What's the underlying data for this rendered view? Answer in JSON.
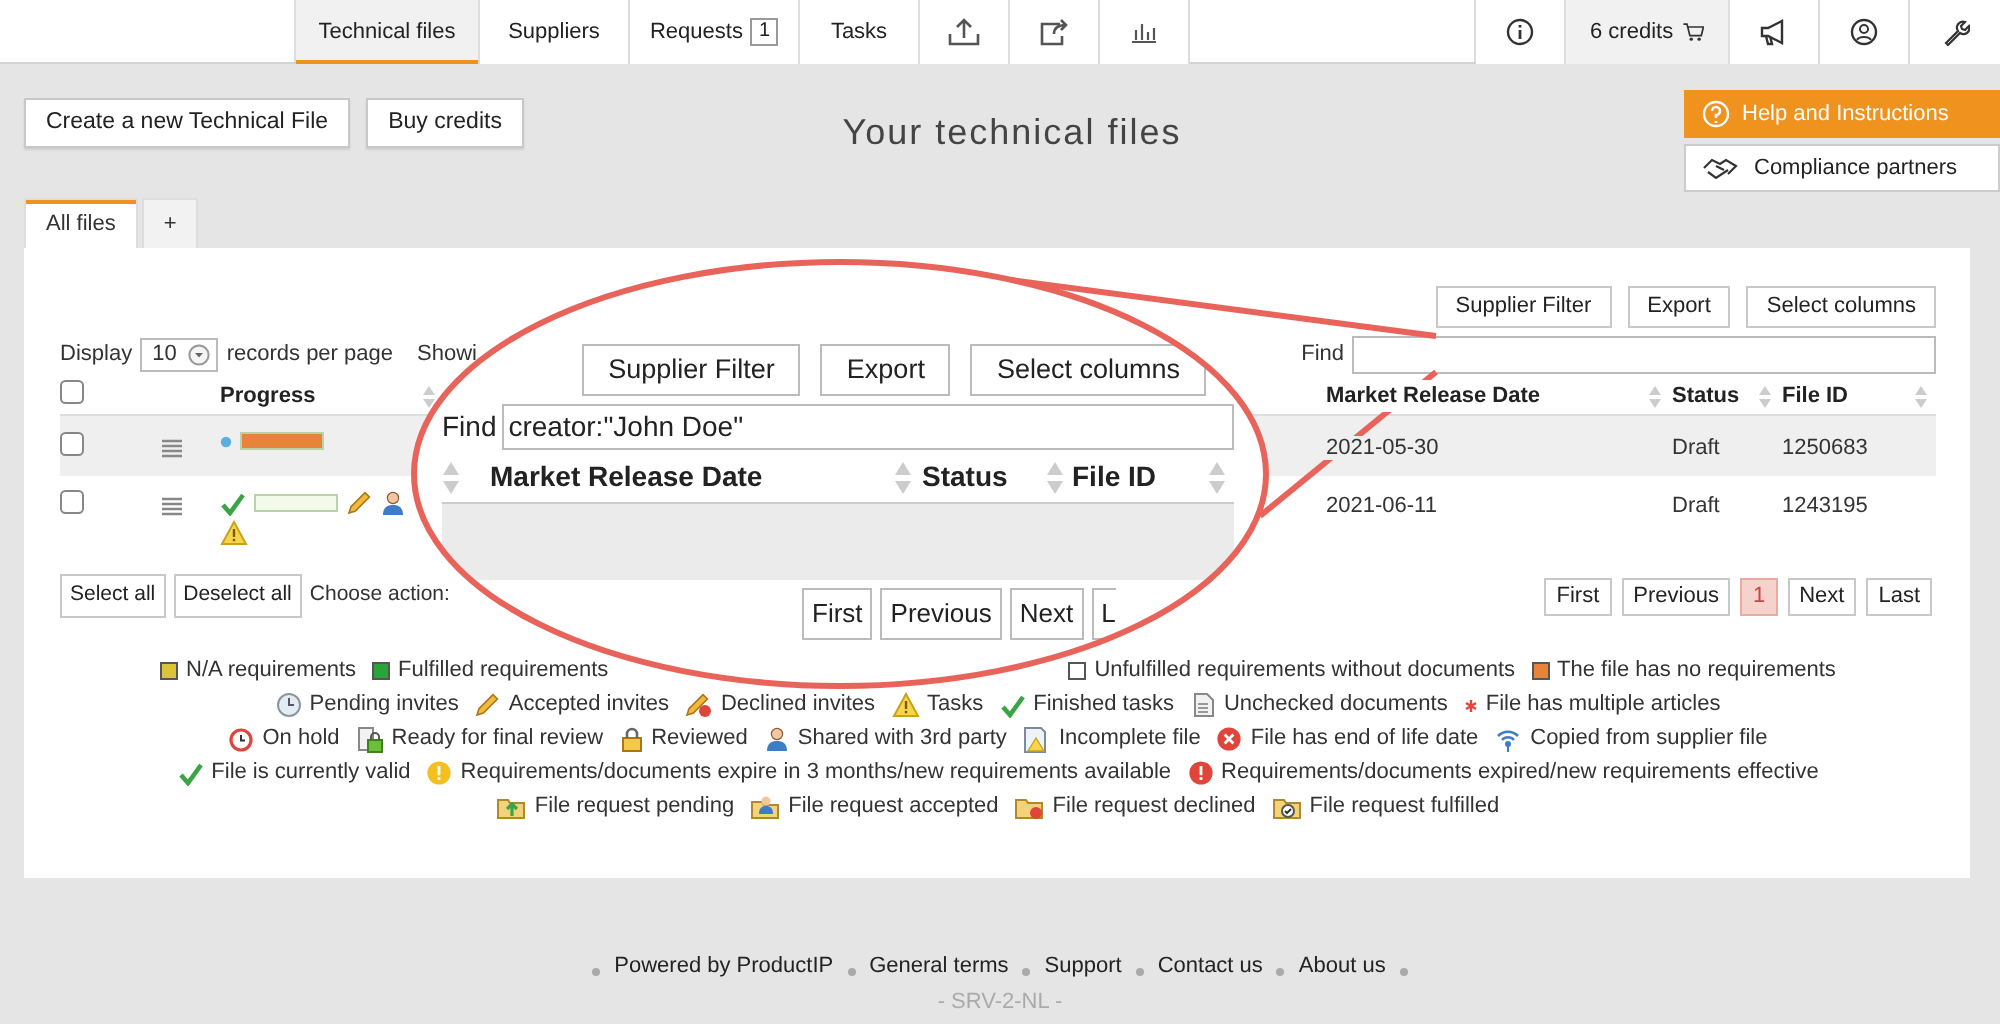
{
  "nav": {
    "tabs": [
      {
        "label": "Technical files",
        "selected": true
      },
      {
        "label": "Suppliers",
        "selected": false
      },
      {
        "label": "Requests",
        "badge": "1",
        "selected": false
      },
      {
        "label": "Tasks",
        "selected": false
      }
    ],
    "credits": "6 credits"
  },
  "actions": [
    "Create a new Technical File",
    "Buy credits"
  ],
  "page_title": "Your technical files",
  "side_buttons": [
    {
      "label": "Help and Instructions",
      "kind": "help"
    },
    {
      "label": "Compliance partners",
      "kind": "partners"
    }
  ],
  "file_tabs": [
    {
      "label": "All files",
      "selected": true
    },
    {
      "label": "+",
      "selected": false
    }
  ],
  "toolbar": [
    "Supplier Filter",
    "Export",
    "Select columns"
  ],
  "display": {
    "prefix": "Display",
    "value": "10",
    "suffix": "records per page"
  },
  "showing": "Showi",
  "find_label": "Find",
  "table": {
    "select_all_checked": false,
    "columns_left": [
      "Progress"
    ],
    "columns_right": [
      "Market Release Date",
      "Status",
      "File ID"
    ],
    "rows": [
      {
        "checked": false,
        "progress": {
          "level": 1,
          "color": "#e8833a"
        },
        "before": [
          {
            "kind": "dot"
          }
        ],
        "after": [],
        "below": [],
        "market_release_date": "2021-05-30",
        "status": "Draft",
        "file_id": "1250683"
      },
      {
        "checked": false,
        "progress": {
          "level": 0
        },
        "before": [
          {
            "kind": "check"
          }
        ],
        "after": [
          {
            "kind": "pencil"
          },
          {
            "kind": "person"
          }
        ],
        "below": [
          {
            "kind": "warning"
          }
        ],
        "market_release_date": "2021-06-11",
        "status": "Draft",
        "file_id": "1243195"
      }
    ]
  },
  "bulk": [
    "Select all",
    "Deselect all"
  ],
  "choose_action": "Choose action:",
  "pagination": [
    {
      "label": "First",
      "selected": false
    },
    {
      "label": "Previous",
      "selected": false
    },
    {
      "label": "1",
      "selected": true
    },
    {
      "label": "Next",
      "selected": false
    },
    {
      "label": "Last",
      "selected": false
    }
  ],
  "legend": [
    [
      {
        "kind": "swatch",
        "color": "#d9c43a",
        "label": "N/A requirements"
      },
      {
        "kind": "swatch",
        "color": "#2aa33a",
        "label": "Fulfilled requirements"
      },
      {
        "kind": "swatch",
        "color": "#ffffff",
        "label": "Unfulfilled requirements without documents"
      },
      {
        "kind": "swatch",
        "color": "#e8833a",
        "label": "The file has no requirements"
      }
    ],
    [
      {
        "kind": "clock",
        "label": "Pending invites"
      },
      {
        "kind": "pencil",
        "label": "Accepted invites"
      },
      {
        "kind": "declined",
        "label": "Declined invites"
      },
      {
        "kind": "warning",
        "label": "Tasks"
      },
      {
        "kind": "check",
        "label": "Finished tasks"
      },
      {
        "kind": "document",
        "label": "Unchecked documents"
      },
      {
        "kind": "asterisk",
        "label": "File has multiple articles"
      }
    ],
    [
      {
        "kind": "alarm",
        "label": "On hold"
      },
      {
        "kind": "lockdoc",
        "label": "Ready for final review"
      },
      {
        "kind": "lock",
        "label": "Reviewed"
      },
      {
        "kind": "person",
        "label": "Shared with 3rd party"
      },
      {
        "kind": "docwarn",
        "label": "Incomplete file"
      },
      {
        "kind": "redx",
        "label": "File has end of life date"
      },
      {
        "kind": "signal",
        "label": "Copied from supplier file"
      }
    ],
    [
      {
        "kind": "check",
        "label": "File is currently valid"
      },
      {
        "kind": "info_yellow",
        "label": "Requirements/documents expire in 3 months/new requirements available"
      },
      {
        "kind": "info_red",
        "label": "Requirements/documents expired/new requirements effective"
      }
    ],
    [
      {
        "kind": "folder_up",
        "label": "File request pending"
      },
      {
        "kind": "folder_person",
        "label": "File request accepted"
      },
      {
        "kind": "folder_x",
        "label": "File request declined"
      },
      {
        "kind": "folder_check",
        "label": "File request fulfilled"
      }
    ]
  ],
  "footer": {
    "links": [
      "Powered by ProductIP",
      "General terms",
      "Support",
      "Contact us",
      "About us"
    ],
    "server": "- SRV-2-NL -"
  },
  "callout": {
    "toolbar": [
      "Supplier Filter",
      "Export",
      "Select columns"
    ],
    "find_label": "Find",
    "find_value": "creator:\"John Doe\"",
    "columns": [
      "Market Release Date",
      "Status",
      "File ID"
    ],
    "pagination": [
      "First",
      "Previous",
      "Next",
      "L"
    ]
  }
}
